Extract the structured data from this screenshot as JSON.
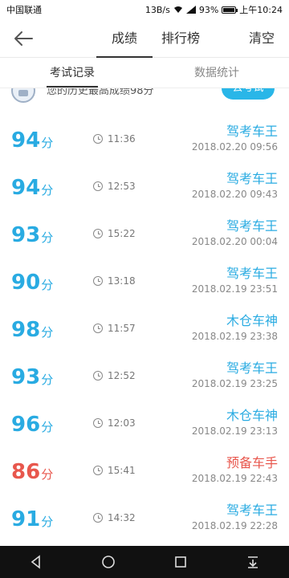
{
  "status": {
    "carrier": "中国联通",
    "speed": "13B/s",
    "battery": "93%",
    "battery_level": 0.93,
    "time": "上午10:24"
  },
  "header": {
    "tabs": [
      {
        "label": "成绩"
      },
      {
        "label": "排行榜"
      }
    ],
    "clear_label": "清空"
  },
  "subtabs": [
    {
      "label": "考试记录"
    },
    {
      "label": "数据统计"
    }
  ],
  "banner": {
    "text": "您的历史最高成绩98分",
    "button": "去考试"
  },
  "records": [
    {
      "score": "94",
      "unit": "分",
      "duration": "11:36",
      "title": "驾考车王",
      "date": "2018.02.20 09:56",
      "color": "#29abe2"
    },
    {
      "score": "94",
      "unit": "分",
      "duration": "12:53",
      "title": "驾考车王",
      "date": "2018.02.20 09:43",
      "color": "#29abe2"
    },
    {
      "score": "93",
      "unit": "分",
      "duration": "15:22",
      "title": "驾考车王",
      "date": "2018.02.20 00:04",
      "color": "#29abe2"
    },
    {
      "score": "90",
      "unit": "分",
      "duration": "13:18",
      "title": "驾考车王",
      "date": "2018.02.19 23:51",
      "color": "#29abe2"
    },
    {
      "score": "98",
      "unit": "分",
      "duration": "11:57",
      "title": "木仓车神",
      "date": "2018.02.19 23:38",
      "color": "#29abe2"
    },
    {
      "score": "93",
      "unit": "分",
      "duration": "12:52",
      "title": "驾考车王",
      "date": "2018.02.19 23:25",
      "color": "#29abe2"
    },
    {
      "score": "96",
      "unit": "分",
      "duration": "12:03",
      "title": "木仓车神",
      "date": "2018.02.19 23:13",
      "color": "#29abe2"
    },
    {
      "score": "86",
      "unit": "分",
      "duration": "15:41",
      "title": "预备车手",
      "date": "2018.02.19 22:43",
      "color": "#e8574d"
    },
    {
      "score": "91",
      "unit": "分",
      "duration": "14:32",
      "title": "驾考车王",
      "date": "2018.02.19 22:28",
      "color": "#29abe2"
    }
  ]
}
